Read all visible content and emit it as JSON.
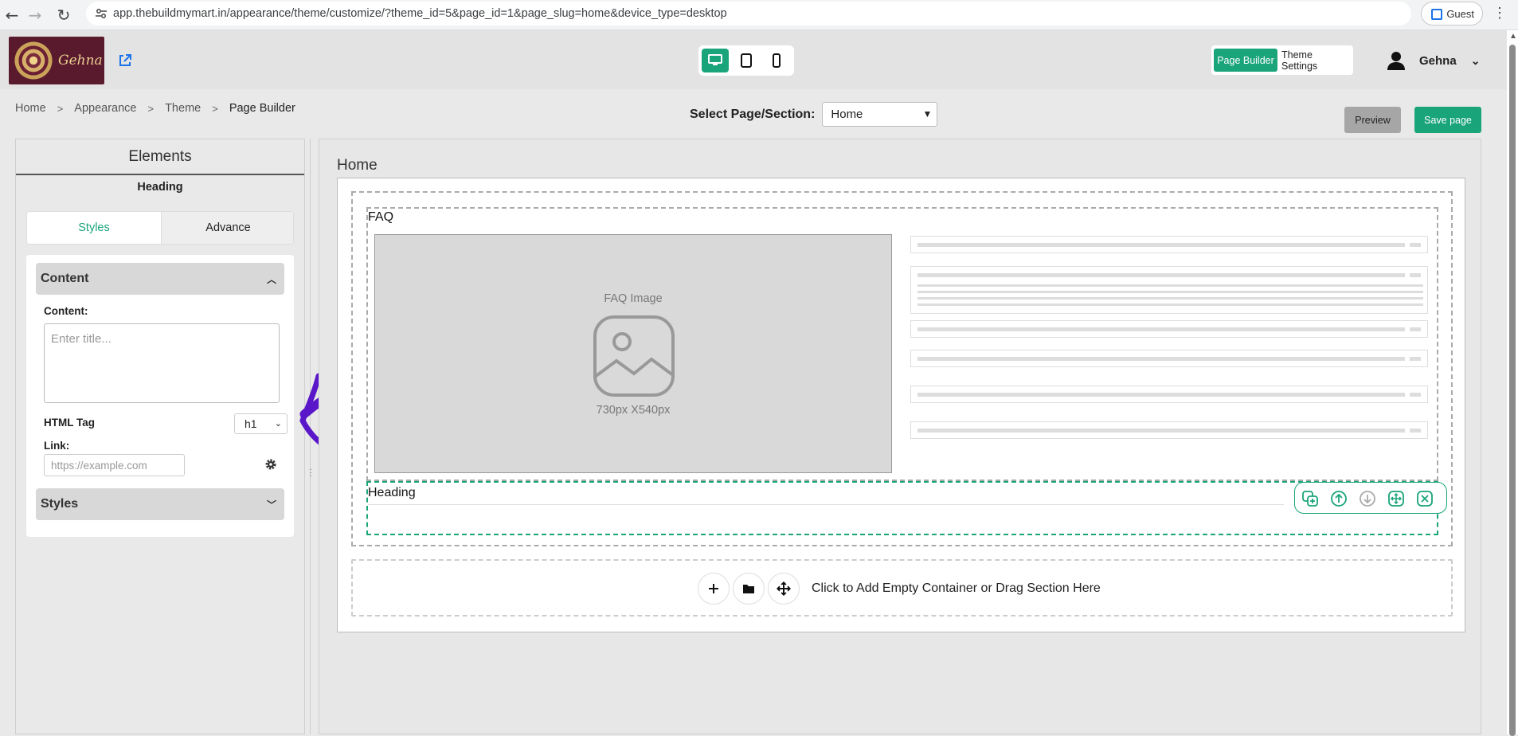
{
  "browser": {
    "url": "app.thebuildmymart.in/appearance/theme/customize/?theme_id=5&page_id=1&page_slug=home&device_type=desktop",
    "profile_label": "Guest"
  },
  "header": {
    "logo_text": "Gehna",
    "page_builder_label": "Page Builder",
    "theme_settings_label": "Theme Settings",
    "user_name": "Gehna"
  },
  "breadcrumb": [
    "Home",
    "Appearance",
    "Theme",
    "Page Builder"
  ],
  "page_select": {
    "label": "Select Page/Section:",
    "value": "Home"
  },
  "actions": {
    "preview_label": "Preview",
    "save_label": "Save page"
  },
  "left_panel": {
    "title": "Elements",
    "subtitle": "Heading",
    "tabs": [
      "Styles",
      "Advance"
    ],
    "content_section": "Content",
    "content_label": "Content:",
    "content_placeholder": "Enter title...",
    "html_tag_label": "HTML Tag",
    "html_tag_value": "h1",
    "link_label": "Link:",
    "link_placeholder": "https://example.com",
    "styles_section": "Styles"
  },
  "canvas": {
    "title": "Home",
    "faq_label": "FAQ",
    "image_title": "FAQ Image",
    "image_size": "730px X540px",
    "heading_label": "Heading",
    "add_text": "Click to Add Empty Container or Drag Section Here"
  },
  "colors": {
    "accent": "#19a47a",
    "annotation_arrow": "#5a16c9"
  }
}
